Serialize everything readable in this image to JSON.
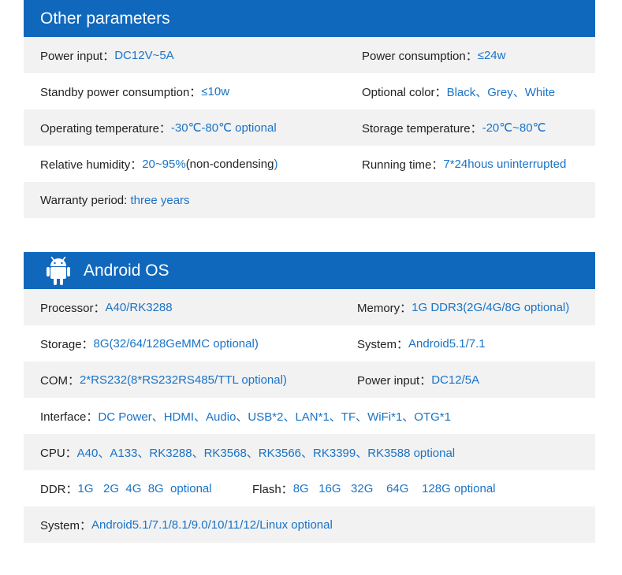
{
  "other": {
    "title": "Other parameters",
    "rows": [
      {
        "a_label": "Power input：",
        "a_value": "DC12V~5A",
        "b_label": "Power consumption：",
        "b_value": "≤24w"
      },
      {
        "a_label": "Standby power consumption：",
        "a_value": "≤10w",
        "b_label": "Optional color：",
        "b_value": "Black、Grey、White"
      },
      {
        "a_label": "Operating temperature：",
        "a_value": "-30℃-80℃ optional",
        "b_label": "Storage temperature：",
        "b_value": "-20℃~80℃"
      },
      {
        "a_label": "Relative humidity：",
        "a_value": "20~95%",
        "a_mid": "(non-condensing",
        "a_end": ")",
        "b_label": "Running time：",
        "b_value": "7*24hous uninterrupted"
      },
      {
        "a_label": "Warranty period: ",
        "a_value": "three years"
      }
    ]
  },
  "android": {
    "title": "Android OS",
    "icon": "android-icon",
    "rows": [
      {
        "a_label": "Processor：",
        "a_value": "A40/RK3288",
        "b_label": "Memory：",
        "b_value": "1G DDR3(2G/4G/8G optional)"
      },
      {
        "a_label": "Storage：",
        "a_value": "8G(32/64/128GeMMC optional)",
        "b_label": "System：",
        "b_value": "Android5.1/7.1"
      },
      {
        "a_label": "COM：",
        "a_value": "2*RS232(8*RS232RS485/TTL optional)",
        "b_label": "Power input：",
        "b_value": "DC12/5A"
      },
      {
        "a_label": "Interface：",
        "a_value": "DC Power、HDMI、Audio、USB*2、LAN*1、TF、WiFi*1、OTG*1"
      },
      {
        "a_label": "CPU：",
        "a_value": "A40、A133、RK3288、RK3568、RK3566、RK3399、RK3588 optional"
      },
      {
        "a_label": "DDR：",
        "a_value": "1G   2G  4G  8G  optional",
        "b_label": "Flash：",
        "b_value": "8G   16G   32G    64G    128G optional"
      },
      {
        "a_label": "System：",
        "a_value": "Android5.1/7.1/8.1/9.0/10/11/12/Linux optional"
      }
    ]
  },
  "colors": {
    "header": "#1068bd",
    "value": "#1a73c6",
    "stripe": "#f2f2f2"
  }
}
